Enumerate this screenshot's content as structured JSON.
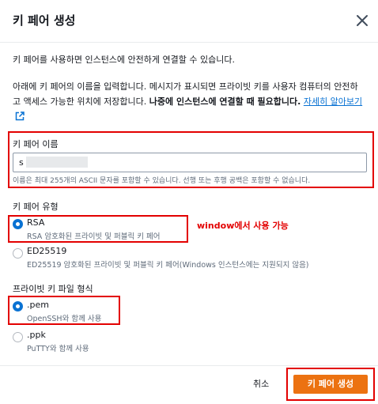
{
  "dialog": {
    "title": "키 페어 생성",
    "intro": "키 페어를 사용하면 인스턴스에 안전하게 연결할 수 있습니다.",
    "description": "아래에 키 페어의 이름을 입력합니다. 메시지가 표시되면 프라이빗 키를 사용자 컴퓨터의 안전하고 액세스 가능한 위치에 저장합니다. ",
    "description_bold": "나중에 인스턴스에 연결할 때 필요합니다.",
    "learn_more_link": "자세히 알아보기"
  },
  "key_name": {
    "label": "키 페어 이름",
    "value": "s",
    "hint": "이름은 최대 255개의 ASCII 문자를 포함할 수 있습니다. 선행 또는 후행 공백은 포함할 수 없습니다."
  },
  "key_type": {
    "label": "키 페어 유형",
    "options": [
      {
        "title": "RSA",
        "description": "RSA 암호화된 프라이빗 및 퍼블릭 키 페어",
        "selected": true
      },
      {
        "title": "ED25519",
        "description": "ED25519 암호화된 프라이빗 및 퍼블릭 키 페어(Windows 인스턴스에는 지원되지 않음)",
        "selected": false
      }
    ],
    "annotation": "window에서 사용 가능"
  },
  "file_format": {
    "label": "프라이빗 키 파일 형식",
    "options": [
      {
        "title": ".pem",
        "description": "OpenSSH와 함께 사용",
        "selected": true
      },
      {
        "title": ".ppk",
        "description": "PuTTY와 함께 사용",
        "selected": false
      }
    ]
  },
  "footer": {
    "cancel_label": "취소",
    "create_label": "키 페어 생성"
  },
  "colors": {
    "primary_button": "#ec7211",
    "radio_selected": "#0972d3",
    "link": "#0972d3",
    "annotation_red": "#e30000"
  },
  "icons": {
    "close": "close-icon",
    "external_link": "external-link-icon"
  }
}
